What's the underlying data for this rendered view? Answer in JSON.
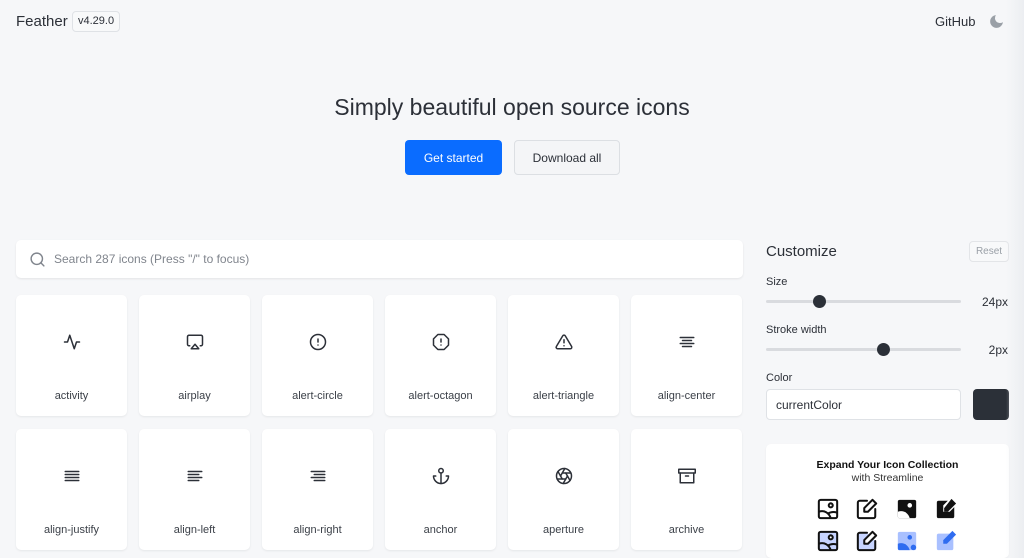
{
  "header": {
    "logo": "Feather",
    "version": "v4.29.0",
    "github_link": "GitHub",
    "theme_toggle_icon": "moon-icon"
  },
  "hero": {
    "title": "Simply beautiful open source icons",
    "primary_button": "Get started",
    "secondary_button": "Download all"
  },
  "search": {
    "icon": "search-icon",
    "placeholder": "Search 287 icons (Press \"/\" to focus)",
    "value": ""
  },
  "icons": [
    {
      "name": "activity"
    },
    {
      "name": "airplay"
    },
    {
      "name": "alert-circle"
    },
    {
      "name": "alert-octagon"
    },
    {
      "name": "alert-triangle"
    },
    {
      "name": "align-center"
    },
    {
      "name": "align-justify"
    },
    {
      "name": "align-left"
    },
    {
      "name": "align-right"
    },
    {
      "name": "anchor"
    },
    {
      "name": "aperture"
    },
    {
      "name": "archive"
    }
  ],
  "customize": {
    "title": "Customize",
    "reset_label": "Reset",
    "size": {
      "label": "Size",
      "value": 24,
      "display": "24px",
      "min": 12,
      "max": 56
    },
    "stroke_width": {
      "label": "Stroke width",
      "value": 2,
      "display": "2px",
      "min": 0.5,
      "max": 3
    },
    "color": {
      "label": "Color",
      "value": "currentColor",
      "swatch": "#2b3038"
    }
  },
  "promo": {
    "title": "Expand Your Icon Collection",
    "subtitle": "with Streamline",
    "icons": [
      "image-outline-icon",
      "edit-outline-icon",
      "image-solid-icon",
      "edit-solid-icon",
      "image-duo-icon",
      "edit-duo-icon",
      "image-flat-icon",
      "edit-flat-icon"
    ],
    "accent_color": "#2f6cf0"
  },
  "colors": {
    "primary": "#0a6cff",
    "background": "#f6f7f9",
    "text": "#2c3038"
  }
}
